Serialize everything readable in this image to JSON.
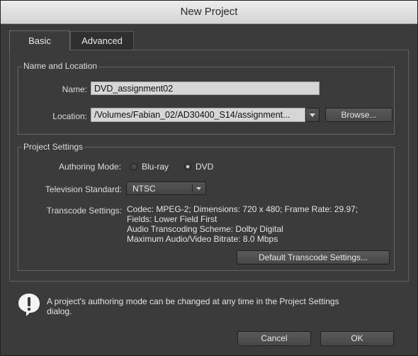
{
  "window": {
    "title": "New Project"
  },
  "tabs": [
    {
      "label": "Basic",
      "active": true
    },
    {
      "label": "Advanced",
      "active": false
    }
  ],
  "name_location": {
    "title": "Name and Location",
    "name_label": "Name:",
    "name_value": "DVD_assignment02",
    "location_label": "Location:",
    "location_value": "/Volumes/Fabian_02/AD30400_S14/assignment...",
    "browse_label": "Browse..."
  },
  "project_settings": {
    "title": "Project Settings",
    "authoring_label": "Authoring Mode:",
    "authoring_options": [
      {
        "label": "Blu-ray",
        "selected": false
      },
      {
        "label": "DVD",
        "selected": true
      }
    ],
    "tv_label": "Television Standard:",
    "tv_value": "NTSC",
    "transcode_label": "Transcode Settings:",
    "transcode_lines": [
      "Codec: MPEG-2; Dimensions: 720 x 480; Frame Rate: 29.97;",
      "Fields: Lower Field First",
      "Audio Transcoding Scheme: Dolby Digital",
      "Maximum Audio/Video Bitrate: 8.0 Mbps"
    ],
    "default_transcode_label": "Default Transcode Settings..."
  },
  "info": {
    "icon": "exclamation-icon",
    "lines": [
      "A project's authoring mode can be changed at any time in the Project Settings",
      "dialog."
    ]
  },
  "buttons": {
    "cancel": "Cancel",
    "ok": "OK"
  },
  "colors": {
    "dialog_bg": "#3b3b3b",
    "field_bg": "#d6d6d6",
    "titlebar_bg": "#dcdcdc"
  }
}
